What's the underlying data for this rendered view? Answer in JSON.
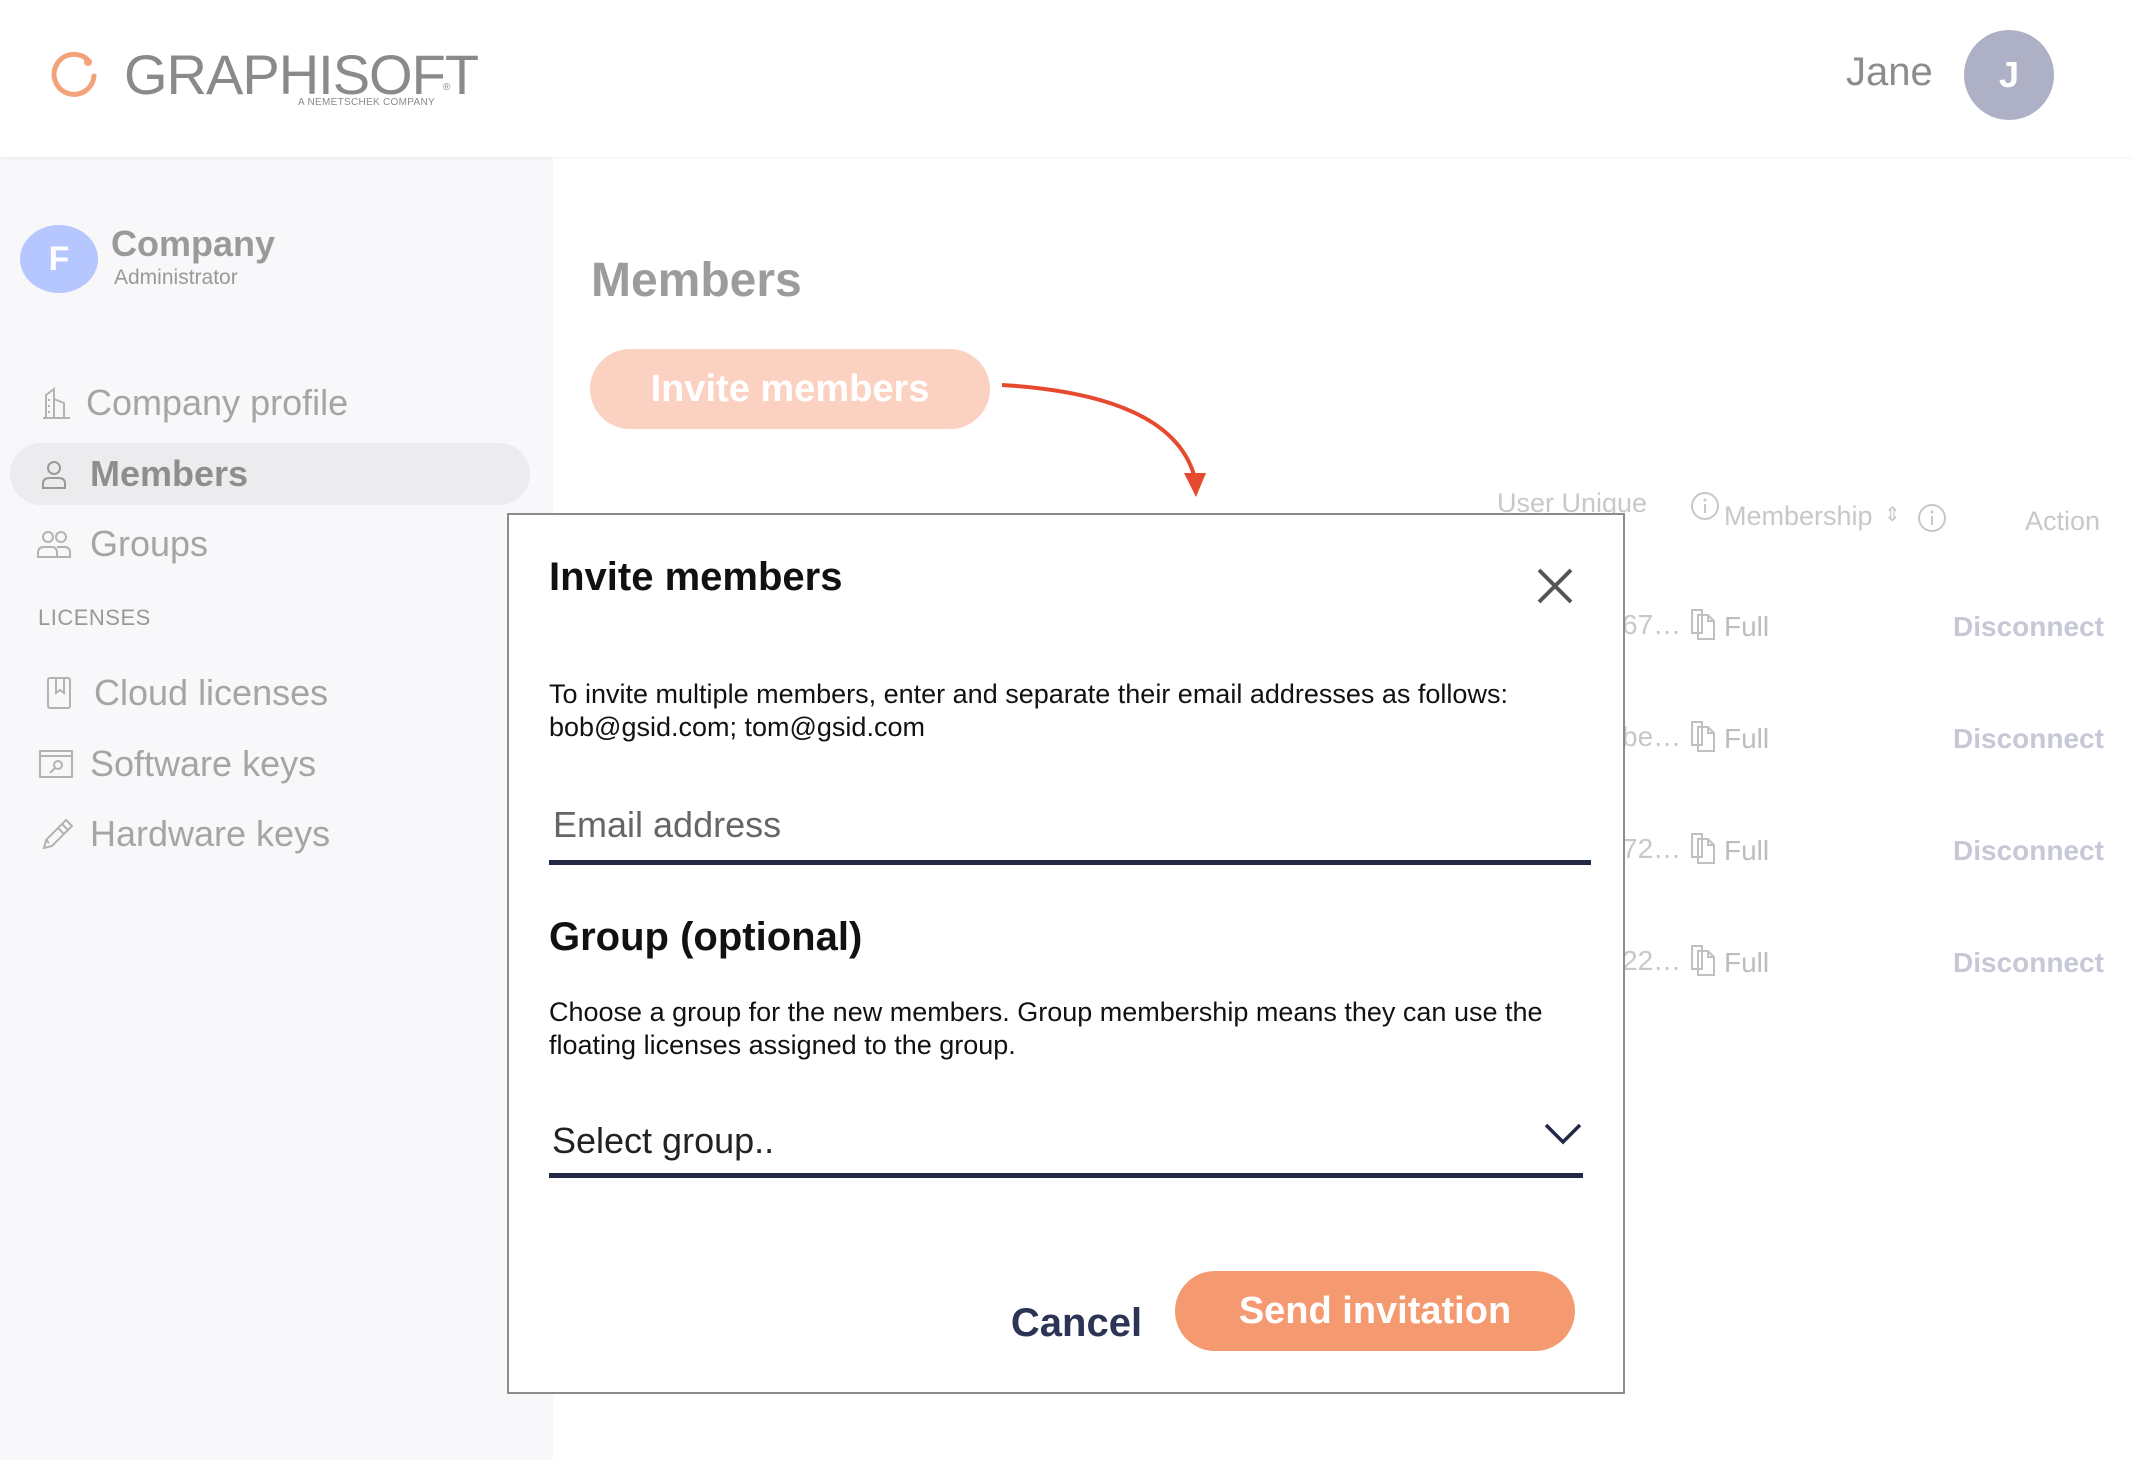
{
  "header": {
    "brand": "GRAPHISOFT",
    "brand_sub": "A NEMETSCHEK COMPANY",
    "registered_mark": "®",
    "user_name": "Jane",
    "user_initial": "J"
  },
  "sidebar": {
    "company_initial": "F",
    "company_name": "Company",
    "company_role": "Administrator",
    "items": [
      {
        "label": "Company profile",
        "icon": "building-icon"
      },
      {
        "label": "Members",
        "icon": "user-icon",
        "active": true
      },
      {
        "label": "Groups",
        "icon": "users-icon"
      }
    ],
    "licenses_heading": "LICENSES",
    "license_items": [
      {
        "label": "Cloud licenses",
        "icon": "cloud-license-icon"
      },
      {
        "label": "Software keys",
        "icon": "software-key-icon"
      },
      {
        "label": "Hardware keys",
        "icon": "hardware-key-icon"
      }
    ]
  },
  "main": {
    "title": "Members",
    "invite_button": "Invite members",
    "columns": {
      "user_unique": "User Unique",
      "membership": "Membership",
      "action": "Action"
    },
    "rows": [
      {
        "id": "67…",
        "membership": "Full",
        "action": "Disconnect"
      },
      {
        "id": "be…",
        "membership": "Full",
        "action": "Disconnect"
      },
      {
        "id": "72…",
        "membership": "Full",
        "action": "Disconnect"
      },
      {
        "id": "22…",
        "membership": "Full",
        "action": "Disconnect"
      }
    ]
  },
  "modal": {
    "title": "Invite members",
    "instructions": "To invite multiple members, enter and separate their email addresses as follows: bob@gsid.com; tom@gsid.com",
    "email_placeholder": "Email address",
    "email_value": "",
    "group_title": "Group (optional)",
    "group_description": "Choose a group for the new members. Group membership means they can use the floating licenses assigned to the group.",
    "group_select_value": "Select group..",
    "cancel_label": "Cancel",
    "send_label": "Send invitation"
  },
  "colors": {
    "accent": "#f59a70",
    "accent_faded": "#fbd2c2",
    "annotation_arrow": "#e64a2e",
    "navy": "#222846"
  }
}
